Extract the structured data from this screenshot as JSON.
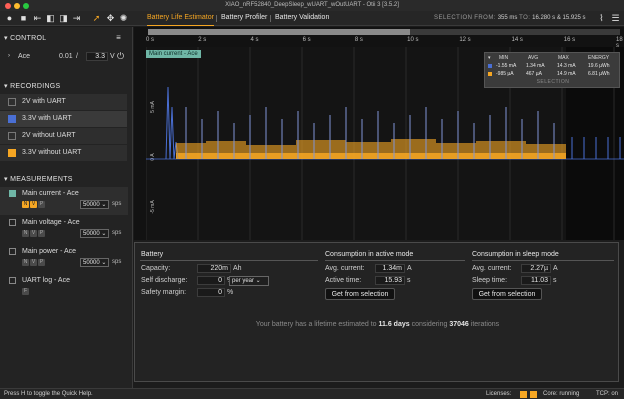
{
  "window": {
    "title": "XIAO_nRF52840_DeepSleep_wUART_wOutUART - Otii 3 [3.5.2]"
  },
  "toolbar": {
    "tabs": [
      "Battery Life Estimator",
      "Battery Profiler",
      "Battery Validation"
    ],
    "selection_label": "SELECTION",
    "from_label": "FROM:",
    "from_value": "355 ms",
    "to_label": "TO:",
    "to_value": "16.280 s",
    "and_label": "&",
    "duration": "15.925 s"
  },
  "sidebar": {
    "control": {
      "header": "CONTROL",
      "device": "Ace",
      "current_value": "0.01",
      "voltage_value": "3.3",
      "voltage_unit": "V"
    },
    "recordings": {
      "header": "RECORDINGS",
      "items": [
        {
          "label": "2V with UART",
          "color": "#2e2e2e"
        },
        {
          "label": "3.3V with UART",
          "color": "#4a6fd4"
        },
        {
          "label": "2V without UART",
          "color": "#2e2e2e"
        },
        {
          "label": "3.3V without UART",
          "color": "#f5a623"
        }
      ]
    },
    "measurements": {
      "header": "MEASUREMENTS",
      "items": [
        {
          "label": "Main current - Ace",
          "rate": "50000",
          "unit": "sps"
        },
        {
          "label": "Main voltage - Ace",
          "rate": "50000",
          "unit": "sps"
        },
        {
          "label": "Main power - Ace",
          "rate": "50000",
          "unit": "sps"
        },
        {
          "label": "UART log - Ace"
        }
      ],
      "chip_letters": [
        "N",
        "V",
        "P"
      ],
      "uart_chip": "F"
    }
  },
  "chart": {
    "series_label": "Main current - Ace",
    "x_ticks": [
      "0 s",
      "2 s",
      "4 s",
      "6 s",
      "8 s",
      "10 s",
      "12 s",
      "14 s",
      "16 s",
      "18 s"
    ],
    "y_ticks": [
      "5 mA",
      "0 A",
      "-5 mA"
    ],
    "stats": {
      "headers": [
        "MIN",
        "AVG",
        "MAX",
        "ENERGY"
      ],
      "rows": [
        {
          "color": "#4a6fd4",
          "min": "-1.55 mA",
          "avg": "1.34 mA",
          "max": "14.3 mA",
          "energy": "19.6 µWh"
        },
        {
          "color": "#f5a623",
          "min": "-985 µA",
          "avg": "467 µA",
          "max": "14.9 mA",
          "energy": "6.81 µWh"
        }
      ],
      "footer": "SELECTION"
    },
    "colors": {
      "series_blue": "#4a6fd4",
      "series_orange": "#f5a623"
    }
  },
  "battery": {
    "title": "Battery",
    "capacity_label": "Capacity:",
    "capacity_value": "220m",
    "capacity_unit": "Ah",
    "self_discharge_label": "Self discharge:",
    "self_discharge_value": "0",
    "self_discharge_unit": "%",
    "self_discharge_period": "per year",
    "safety_margin_label": "Safety margin:",
    "safety_margin_value": "0",
    "safety_margin_unit": "%",
    "active": {
      "title": "Consumption in active mode",
      "avg_label": "Avg. current:",
      "avg_value": "1.34m",
      "avg_unit": "A",
      "time_label": "Active time:",
      "time_value": "15.93",
      "time_unit": "s",
      "button": "Get from selection"
    },
    "sleep": {
      "title": "Consumption in sleep mode",
      "avg_label": "Avg. current:",
      "avg_value": "2.27µ",
      "avg_unit": "A",
      "time_label": "Sleep time:",
      "time_value": "11.03",
      "time_unit": "s",
      "button": "Get from selection"
    },
    "lifetime": {
      "prefix": "Your battery has a lifetime estimated to",
      "days": "11.6 days",
      "middle": "considering",
      "iterations": "37046",
      "suffix": "iterations"
    }
  },
  "status": {
    "help": "Press H to toggle the Quick Help.",
    "licenses_label": "Licenses:",
    "core_label": "Core: running",
    "tcp_label": "TCP: on"
  }
}
